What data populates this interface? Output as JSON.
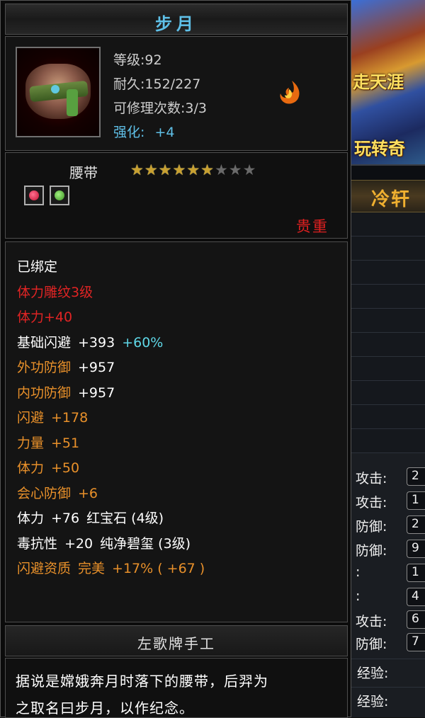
{
  "item": {
    "name": "步月",
    "level": "等级:92",
    "durability": "耐久:152/227",
    "repairs": "可修理次数:3/3",
    "enhance_label": "强化:",
    "enhance_value": "+4",
    "type": "腰带",
    "stars_filled": 6,
    "stars_total": 9,
    "rarity": "贵重",
    "maker": "左歌牌手工",
    "description_lines": [
      "据说是嫦娥奔月时落下的腰带，后羿为",
      "之取名曰步月，以作纪念。"
    ]
  },
  "attributes": [
    {
      "label": "已绑定",
      "value": "",
      "extra": "",
      "color": "#ffffff"
    },
    {
      "label": "体力雕纹3级",
      "value": "",
      "extra": "",
      "color": "#e02424"
    },
    {
      "label": "体力+40",
      "value": "",
      "extra": "",
      "color": "#e02424"
    },
    {
      "label": "基础闪避",
      "value": "+393",
      "extra": "+60%",
      "color": "#ffffff",
      "extra_color": "#5fd8e8"
    },
    {
      "label": "外功防御",
      "value": "+957",
      "extra": "",
      "color": "#e8902a",
      "value_color": "#ffffff"
    },
    {
      "label": "内功防御",
      "value": "+957",
      "extra": "",
      "color": "#e8902a",
      "value_color": "#ffffff"
    },
    {
      "label": "闪避",
      "value": "+178",
      "extra": "",
      "color": "#e8902a"
    },
    {
      "label": "力量",
      "value": "+51",
      "extra": "",
      "color": "#e8902a"
    },
    {
      "label": "体力",
      "value": "+50",
      "extra": "",
      "color": "#e8902a"
    },
    {
      "label": "会心防御",
      "value": "+6",
      "extra": "",
      "color": "#e8902a"
    },
    {
      "label": "体力",
      "value": "+76",
      "extra": "红宝石 (4级)",
      "color": "#ffffff"
    },
    {
      "label": "毒抗性",
      "value": "+20",
      "extra": "纯净碧玺 (3级)",
      "color": "#ffffff"
    },
    {
      "label": "闪避资质",
      "value": "完美",
      "extra": "+17% ( +67 )",
      "color": "#e8902a",
      "value_color": "#e8902a"
    }
  ],
  "background": {
    "banner_text": [
      "走天涯",
      "玩转奇"
    ],
    "panel_title": "冷轩",
    "stats": [
      {
        "label": "攻击:",
        "value": "2"
      },
      {
        "label": "攻击:",
        "value": "1"
      },
      {
        "label": "防御:",
        "value": "2"
      },
      {
        "label": "防御:",
        "value": "9"
      },
      {
        "label": ":",
        "value": "1"
      },
      {
        "label": ":",
        "value": "4"
      },
      {
        "label": "攻击:",
        "value": "6"
      },
      {
        "label": "防御:",
        "value": "7"
      }
    ],
    "exp_labels": [
      "经验:",
      "经验:"
    ]
  },
  "colors": {
    "title": "#5fc0e8",
    "rarity": "#e02020",
    "star_on": "#c8a030",
    "star_off": "#6a6a6a"
  },
  "icons": {
    "item": "belt-icon",
    "quality": "flame-icon",
    "socket_1": "red-gem-socket-icon",
    "socket_2": "green-gem-socket-icon"
  }
}
